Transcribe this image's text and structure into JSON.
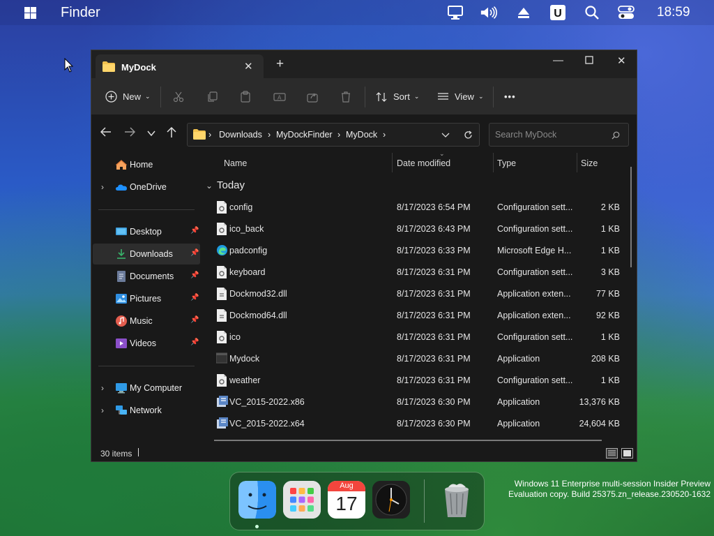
{
  "menubar": {
    "app_name": "Finder",
    "time": "18:59",
    "icons": [
      "windows-logo-icon",
      "monitor-icon",
      "volume-icon",
      "eject-icon",
      "u-app-icon",
      "search-icon",
      "control-center-icon"
    ]
  },
  "window": {
    "tab_title": "MyDock",
    "toolbar": {
      "new_label": "New",
      "sort_label": "Sort",
      "view_label": "View",
      "more_label": "•••"
    },
    "breadcrumb": [
      "Downloads",
      "MyDockFinder",
      "MyDock"
    ],
    "search_placeholder": "Search MyDock",
    "nav": {
      "top": [
        {
          "label": "Home",
          "icon": "home-icon"
        },
        {
          "label": "OneDrive",
          "icon": "cloud-icon"
        }
      ],
      "pinned": [
        {
          "label": "Desktop",
          "icon": "desktop-icon"
        },
        {
          "label": "Downloads",
          "icon": "download-icon"
        },
        {
          "label": "Documents",
          "icon": "document-icon"
        },
        {
          "label": "Pictures",
          "icon": "picture-icon"
        },
        {
          "label": "Music",
          "icon": "music-icon"
        },
        {
          "label": "Videos",
          "icon": "video-icon"
        }
      ],
      "bottom": [
        {
          "label": "My Computer",
          "icon": "computer-icon"
        },
        {
          "label": "Network",
          "icon": "network-icon"
        }
      ]
    },
    "columns": {
      "name": "Name",
      "date": "Date modified",
      "type": "Type",
      "size": "Size"
    },
    "group_label": "Today",
    "files": [
      {
        "name": "config",
        "date": "8/17/2023 6:54 PM",
        "type": "Configuration sett...",
        "size": "2 KB",
        "icon": "config-file-icon"
      },
      {
        "name": "ico_back",
        "date": "8/17/2023 6:43 PM",
        "type": "Configuration sett...",
        "size": "1 KB",
        "icon": "config-file-icon"
      },
      {
        "name": "padconfig",
        "date": "8/17/2023 6:33 PM",
        "type": "Microsoft Edge H...",
        "size": "1 KB",
        "icon": "edge-icon"
      },
      {
        "name": "keyboard",
        "date": "8/17/2023 6:31 PM",
        "type": "Configuration sett...",
        "size": "3 KB",
        "icon": "config-file-icon"
      },
      {
        "name": "Dockmod32.dll",
        "date": "8/17/2023 6:31 PM",
        "type": "Application exten...",
        "size": "77 KB",
        "icon": "dll-file-icon"
      },
      {
        "name": "Dockmod64.dll",
        "date": "8/17/2023 6:31 PM",
        "type": "Application exten...",
        "size": "92 KB",
        "icon": "dll-file-icon"
      },
      {
        "name": "ico",
        "date": "8/17/2023 6:31 PM",
        "type": "Configuration sett...",
        "size": "1 KB",
        "icon": "config-file-icon"
      },
      {
        "name": "Mydock",
        "date": "8/17/2023 6:31 PM",
        "type": "Application",
        "size": "208 KB",
        "icon": "app-window-icon"
      },
      {
        "name": "weather",
        "date": "8/17/2023 6:31 PM",
        "type": "Configuration sett...",
        "size": "1 KB",
        "icon": "config-file-icon"
      },
      {
        "name": "VC_2015-2022.x86",
        "date": "8/17/2023 6:30 PM",
        "type": "Application",
        "size": "13,376 KB",
        "icon": "installer-icon"
      },
      {
        "name": "VC_2015-2022.x64",
        "date": "8/17/2023 6:30 PM",
        "type": "Application",
        "size": "24,604 KB",
        "icon": "installer-icon"
      }
    ],
    "status": "30 items"
  },
  "dock": {
    "calendar_month": "Aug",
    "calendar_day": "17",
    "apps": [
      "finder-icon",
      "launchpad-icon",
      "calendar-icon",
      "clock-icon",
      "trash-icon"
    ]
  },
  "watermark": {
    "line1": "Windows 11 Enterprise multi-session Insider Preview",
    "line2": "Evaluation copy. Build 25375.zn_release.230520-1632"
  }
}
